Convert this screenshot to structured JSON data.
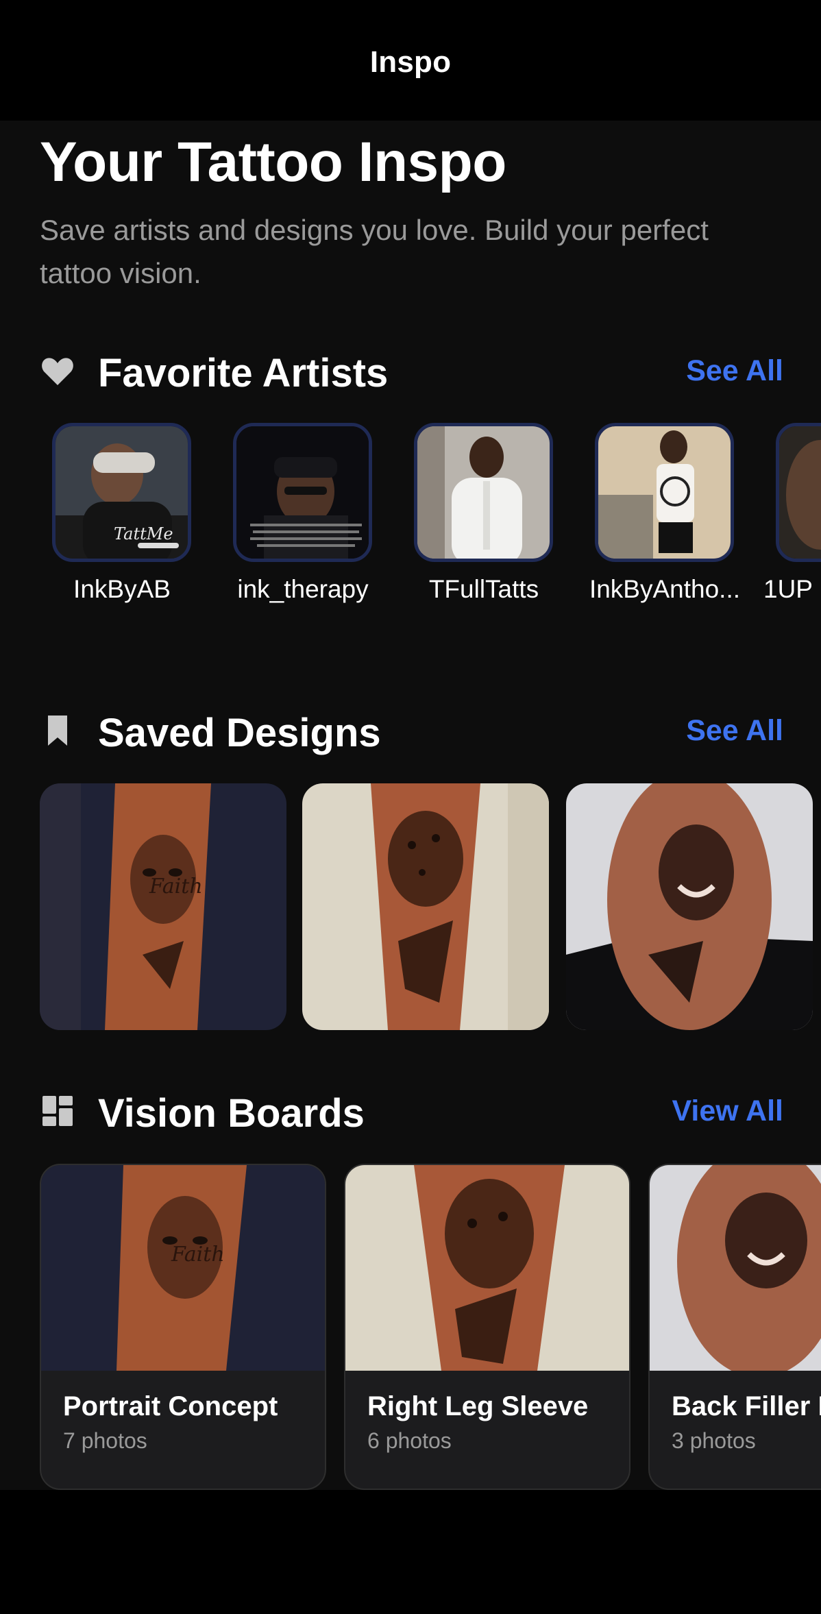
{
  "nav": {
    "title": "Inspo"
  },
  "header": {
    "title": "Your Tattoo Inspo",
    "subtitle": "Save artists and designs you love. Build your perfect tattoo vision."
  },
  "favorite_artists": {
    "title": "Favorite Artists",
    "link": "See All",
    "icon": "heart-icon",
    "items": [
      {
        "name": "InkByAB"
      },
      {
        "name": "ink_therapy"
      },
      {
        "name": "TFullTatts"
      },
      {
        "name": "InkByAntho..."
      },
      {
        "name": "1UP"
      }
    ]
  },
  "saved_designs": {
    "title": "Saved Designs",
    "link": "See All",
    "icon": "bookmark-icon",
    "count_visible": 3
  },
  "vision_boards": {
    "title": "Vision Boards",
    "link": "View All",
    "icon": "dashboard-icon",
    "items": [
      {
        "title": "Portrait Concept",
        "count": "7 photos"
      },
      {
        "title": "Right Leg Sleeve",
        "count": "6 photos"
      },
      {
        "title": "Back Filler I",
        "count": "3 photos"
      }
    ]
  },
  "colors": {
    "background": "#0d0d0d",
    "accent": "#3e73f0",
    "secondary_text": "#9a9a9a",
    "artist_border": "#1f2a55",
    "card": "#1c1c1e"
  }
}
